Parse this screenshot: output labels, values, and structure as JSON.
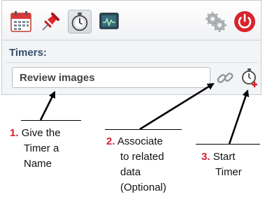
{
  "toolbar": {
    "buttons": [
      {
        "icon": "calendar-icon"
      },
      {
        "icon": "pushpin-icon"
      },
      {
        "icon": "stopwatch-icon",
        "active": true
      },
      {
        "icon": "monitor-chart-icon"
      },
      {
        "icon": "gears-icon"
      },
      {
        "icon": "power-icon"
      }
    ]
  },
  "timers": {
    "title": "Timers:",
    "name_value": "Review images"
  },
  "annotations": [
    {
      "number": "1.",
      "lines": [
        "Give the",
        "Timer a",
        "Name"
      ]
    },
    {
      "number": "2.",
      "lines": [
        "Associate",
        "to related",
        "data",
        "(Optional)"
      ]
    },
    {
      "number": "3.",
      "lines": [
        "Start",
        "Timer"
      ]
    }
  ],
  "colors": {
    "accent_red": "#d6202a",
    "title_blue": "#36506e",
    "power_red": "#d9232d"
  }
}
